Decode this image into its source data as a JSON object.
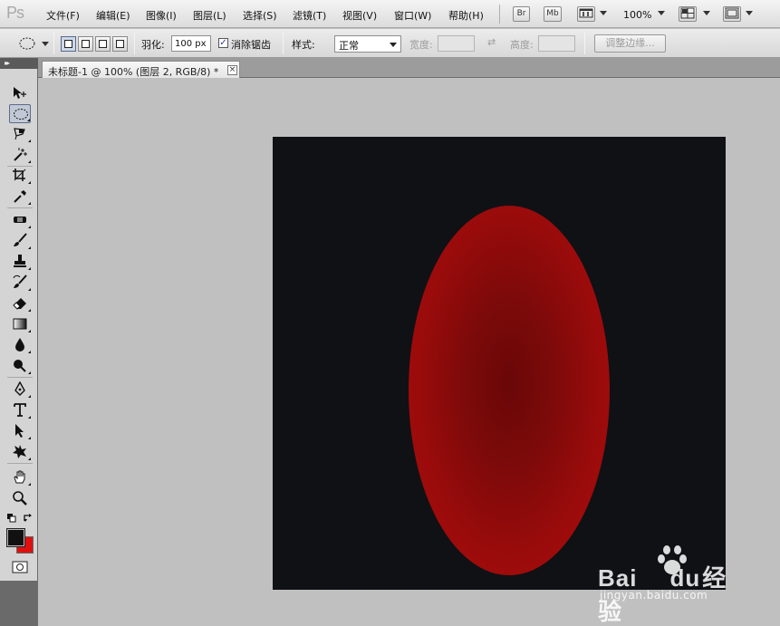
{
  "app": {
    "logo": "Ps"
  },
  "menu": {
    "items": [
      "文件(F)",
      "编辑(E)",
      "图像(I)",
      "图层(L)",
      "选择(S)",
      "滤镜(T)",
      "视图(V)",
      "窗口(W)",
      "帮助(H)"
    ],
    "bridge_label": "Br",
    "minibridge_label": "Mb",
    "zoom": "100%"
  },
  "options": {
    "feather_label": "羽化:",
    "feather_value": "100 px",
    "antialias_checked": "✓",
    "antialias_label": "消除锯齿",
    "style_label": "样式:",
    "style_value": "正常",
    "width_label": "宽度:",
    "swap_icon": "⇄",
    "height_label": "高度:",
    "refine_edge_label": "调整边缘..."
  },
  "document": {
    "tab_title": "未标题-1 @ 100% (图层 2, RGB/8) *",
    "close": "×"
  },
  "tools": [
    "move-tool",
    "elliptical-marquee-tool",
    "lasso-tool",
    "magic-wand-tool",
    "crop-tool",
    "eyedropper-tool",
    "spot-healing-tool",
    "brush-tool",
    "clone-stamp-tool",
    "history-brush-tool",
    "eraser-tool",
    "gradient-tool",
    "blur-tool",
    "dodge-tool",
    "pen-tool",
    "type-tool",
    "path-selection-tool",
    "custom-shape-tool",
    "hand-tool",
    "zoom-tool"
  ],
  "colors": {
    "foreground": "#111111",
    "background": "#e01010",
    "canvas": "#0f1115",
    "ellipse_center": "#6a0707",
    "ellipse_edge": "#b00a0a"
  },
  "watermark": {
    "logo_left": "Bai",
    "logo_right": "du",
    "logo_suffix": "经验",
    "url": "jingyan.baidu.com"
  }
}
